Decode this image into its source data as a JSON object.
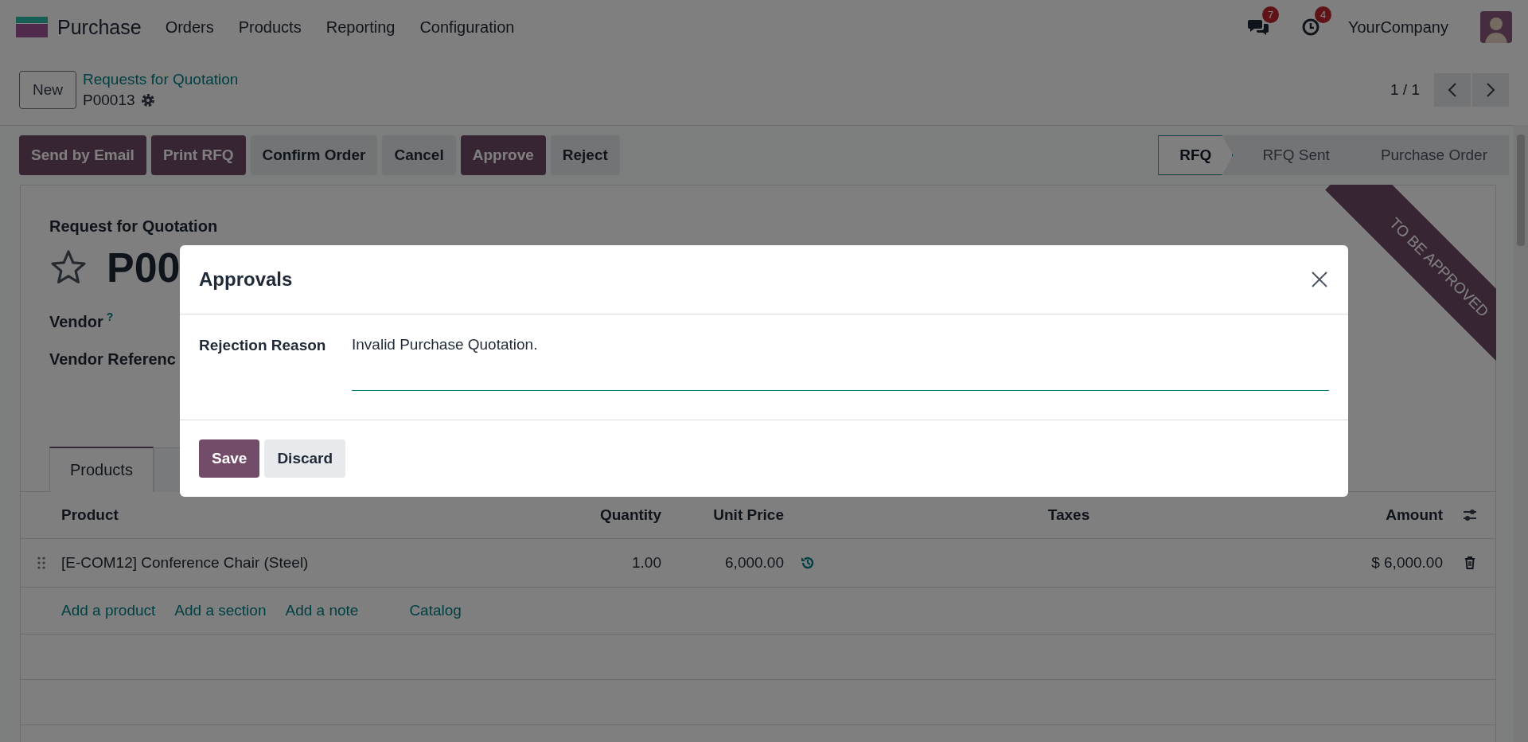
{
  "navbar": {
    "app": "Purchase",
    "menus": [
      "Orders",
      "Products",
      "Reporting",
      "Configuration"
    ],
    "messages_count": "7",
    "activities_count": "4",
    "company": "YourCompany"
  },
  "control_panel": {
    "new_button": "New",
    "breadcrumb": "Requests for Quotation",
    "record": "P00013",
    "pager": "1 / 1"
  },
  "actions": [
    {
      "label": "Send by Email",
      "kind": "primary"
    },
    {
      "label": "Print RFQ",
      "kind": "primary"
    },
    {
      "label": "Confirm Order",
      "kind": "secondary"
    },
    {
      "label": "Cancel",
      "kind": "secondary"
    },
    {
      "label": "Approve",
      "kind": "primary"
    },
    {
      "label": "Reject",
      "kind": "secondary"
    }
  ],
  "statusbar": [
    {
      "label": "RFQ",
      "selected": true
    },
    {
      "label": "RFQ Sent",
      "selected": false
    },
    {
      "label": "Purchase Order",
      "selected": false
    }
  ],
  "form": {
    "ribbon": "TO BE APPROVED",
    "title_label": "Request for Quotation",
    "starred": false,
    "name": "P00",
    "fields": [
      {
        "label": "Vendor",
        "help": "?"
      },
      {
        "label": "Vendor Referenc"
      }
    ],
    "tabs": [
      {
        "label": "Products",
        "selected": true
      }
    ]
  },
  "table": {
    "columns": [
      "Product",
      "Quantity",
      "Unit Price",
      "Taxes",
      "Amount"
    ],
    "rows": [
      {
        "product": "[E-COM12] Conference Chair (Steel)",
        "quantity": "1.00",
        "unit_price": "6,000.00",
        "amount": "$ 6,000.00"
      }
    ],
    "add_links": [
      "Add a product",
      "Add a section",
      "Add a note",
      "Catalog"
    ]
  },
  "dialog": {
    "title": "Approvals",
    "field_label": "Rejection Reason",
    "field_value": "Invalid Purchase Quotation.",
    "buttons": [
      {
        "label": "Save",
        "kind": "primary"
      },
      {
        "label": "Discard",
        "kind": "secondary"
      }
    ]
  }
}
